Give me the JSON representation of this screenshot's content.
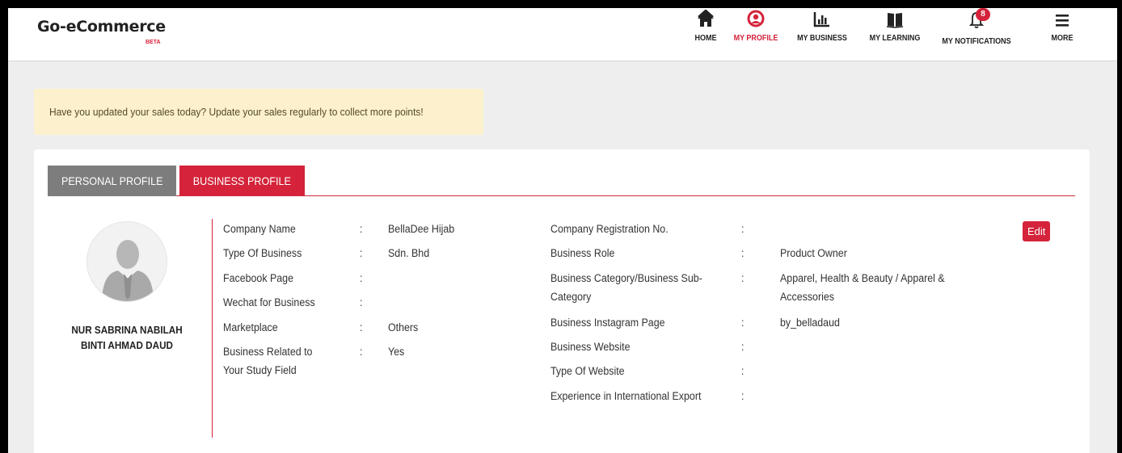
{
  "brand": {
    "name": "Go-eCommerce",
    "tag": "BETA"
  },
  "nav": {
    "home": "HOME",
    "profile": "MY PROFILE",
    "business": "MY BUSINESS",
    "learning": "MY LEARNING",
    "notifications": "MY NOTIFICATIONS",
    "notifications_count": "8",
    "more": "MORE"
  },
  "colors": {
    "accent": "#d4233a",
    "tab_inactive": "#7d7d7d",
    "notice_bg": "#fcf1cc"
  },
  "notice": "Have you updated your sales today? Update your sales regularly to collect more points!",
  "tabs": {
    "personal": "PERSONAL PROFILE",
    "business": "BUSINESS PROFILE"
  },
  "user": {
    "name_line1": "NUR SABRINA NABILAH",
    "name_line2": "BINTI AHMAD DAUD"
  },
  "separator": ":",
  "left_fields": [
    {
      "label": "Company Name",
      "value": "BellaDee Hijab"
    },
    {
      "label": "Type Of Business",
      "value": "Sdn. Bhd"
    },
    {
      "label": "Facebook Page",
      "value": ""
    },
    {
      "label": "Wechat for Business",
      "value": ""
    },
    {
      "label": "Marketplace",
      "value": "Others"
    },
    {
      "label_line1": "Business Related to",
      "label_line2": "Your Study Field",
      "value": "Yes"
    }
  ],
  "right_fields": [
    {
      "label": "Company Registration No.",
      "value": ""
    },
    {
      "label": "Business Role",
      "value": "Product Owner"
    },
    {
      "label_line1": "Business Category/Business Sub-",
      "label_line2": "Category",
      "value_line1": "Apparel, Health & Beauty / Apparel &",
      "value_line2": "Accessories"
    },
    {
      "label": "Business Instagram Page",
      "value": "by_belladaud"
    },
    {
      "label": "Business Website",
      "value": ""
    },
    {
      "label": "Type Of Website",
      "value": ""
    },
    {
      "label": "Experience in International Export",
      "value": ""
    }
  ],
  "edit_label": "Edit"
}
